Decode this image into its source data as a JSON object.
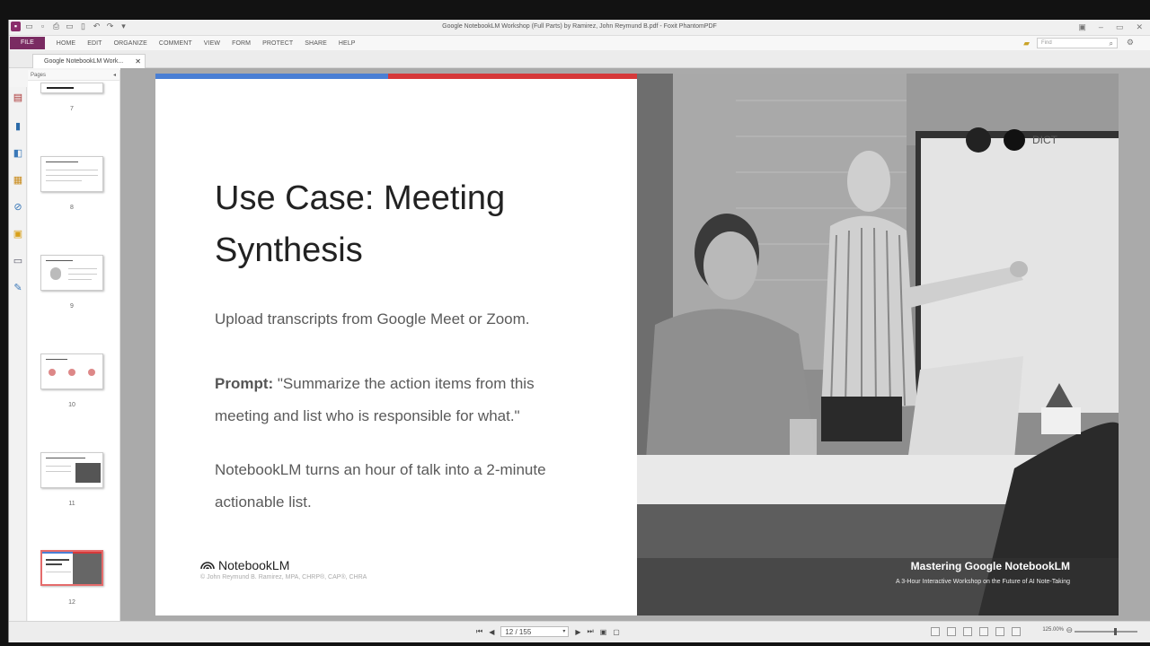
{
  "window": {
    "title": "Google NotebookLM Workshop (Full Parts) by Ramirez, John Reymund B.pdf - Foxit PhantomPDF"
  },
  "menu": {
    "file": "FILE",
    "items": [
      "HOME",
      "EDIT",
      "ORGANIZE",
      "COMMENT",
      "VIEW",
      "FORM",
      "PROTECT",
      "SHARE",
      "HELP"
    ]
  },
  "search": {
    "placeholder": "Find"
  },
  "tab": {
    "label": "Google NotebookLM Work..."
  },
  "pages_panel": {
    "header": "Pages",
    "page_numbers": [
      "7",
      "8",
      "9",
      "10",
      "11",
      "12"
    ],
    "selected": "12"
  },
  "slide": {
    "title": "Use Case: Meeting Synthesis",
    "line1": "Upload transcripts from Google Meet or Zoom.",
    "prompt_label": "Prompt:",
    "prompt_text": " \"Summarize the action items from this meeting and list who is responsible for what.\"",
    "line3": "NotebookLM turns an hour of talk into a 2-minute actionable list.",
    "brand": "NotebookLM",
    "copyright": "© John Reymund B. Ramirez, MPA, CHRP®, CAP®, CHRA",
    "caption_title": "Mastering Google NotebookLM",
    "caption_sub": "A 3-Hour Interactive Workshop on the Future of AI Note-Taking",
    "logo_text": "DICT"
  },
  "statusbar": {
    "page_display": "12 / 155",
    "zoom": "125.00%"
  },
  "colors": {
    "accent": "#7a2b62",
    "blue_bar": "#4a7fd4",
    "red_bar": "#d6393a"
  }
}
